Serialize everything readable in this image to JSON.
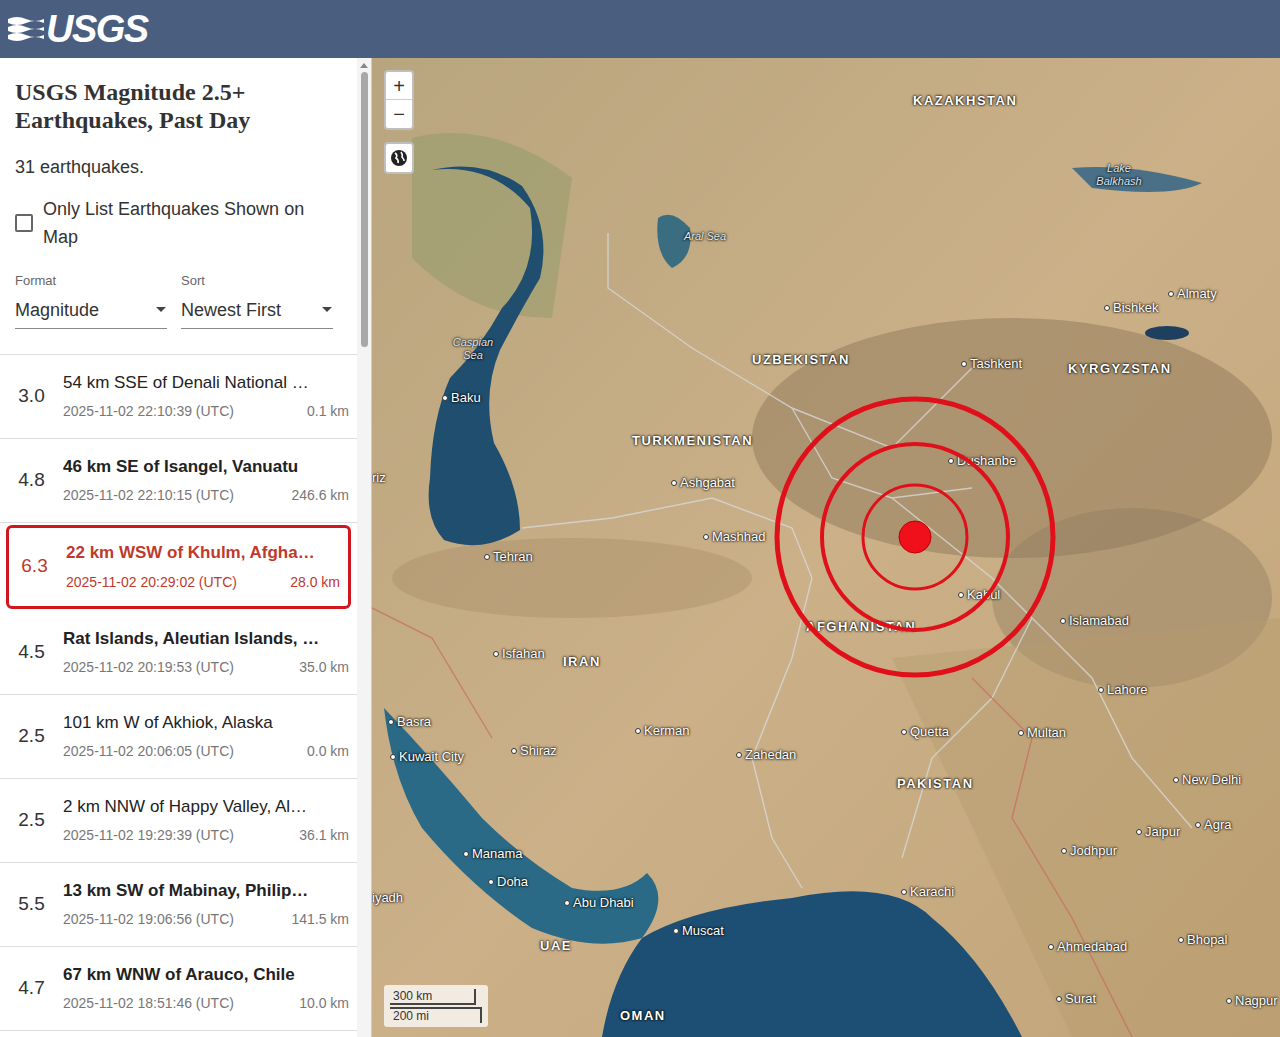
{
  "header": {
    "logo": "USGS"
  },
  "panel": {
    "title": "USGS Magnitude 2.5+ Earthquakes, Past Day",
    "count": "31 earthquakes.",
    "filter": {
      "label": "Only List Earthquakes Shown on Map",
      "checked": false
    },
    "format": {
      "label": "Format",
      "value": "Magnitude"
    },
    "sort": {
      "label": "Sort",
      "value": "Newest First"
    }
  },
  "earthquakes": [
    {
      "magnitude": "3.0",
      "title": "54 km SSE of Denali National …",
      "time": "2025-11-02 22:10:39 (UTC)",
      "depth": "0.1 km",
      "significant": false,
      "selected": false
    },
    {
      "magnitude": "4.8",
      "title": "46 km SE of Isangel, Vanuatu",
      "time": "2025-11-02 22:10:15 (UTC)",
      "depth": "246.6 km",
      "significant": true,
      "selected": false
    },
    {
      "magnitude": "6.3",
      "title": "22 km WSW of Khulm, Afgha…",
      "time": "2025-11-02 20:29:02 (UTC)",
      "depth": "28.0 km",
      "significant": true,
      "selected": true
    },
    {
      "magnitude": "4.5",
      "title": "Rat Islands, Aleutian Islands, …",
      "time": "2025-11-02 20:19:53 (UTC)",
      "depth": "35.0 km",
      "significant": true,
      "selected": false
    },
    {
      "magnitude": "2.5",
      "title": "101 km W of Akhiok, Alaska",
      "time": "2025-11-02 20:06:05 (UTC)",
      "depth": "0.0 km",
      "significant": false,
      "selected": false
    },
    {
      "magnitude": "2.5",
      "title": "2 km NNW of Happy Valley, Al…",
      "time": "2025-11-02 19:29:39 (UTC)",
      "depth": "36.1 km",
      "significant": false,
      "selected": false
    },
    {
      "magnitude": "5.5",
      "title": "13 km SW of Mabinay, Philip…",
      "time": "2025-11-02 19:06:56 (UTC)",
      "depth": "141.5 km",
      "significant": true,
      "selected": false
    },
    {
      "magnitude": "4.7",
      "title": "67 km WNW of Arauco, Chile",
      "time": "2025-11-02 18:51:46 (UTC)",
      "depth": "10.0 km",
      "significant": true,
      "selected": false
    }
  ],
  "map": {
    "zoom_in": "+",
    "zoom_out": "−",
    "scale": {
      "km": "300 km",
      "mi": "200 mi"
    },
    "labels": [
      {
        "text": "KAZAKHSTAN",
        "kind": "country"
      },
      {
        "text": "Lake Balkhash",
        "kind": "water"
      },
      {
        "text": "Aral Sea",
        "kind": "water"
      },
      {
        "text": "Caspian Sea",
        "kind": "water"
      },
      {
        "text": "Bishkek",
        "kind": "city"
      },
      {
        "text": "Almaty",
        "kind": "city"
      },
      {
        "text": "UZBEKISTAN",
        "kind": "country"
      },
      {
        "text": "Tashkent",
        "kind": "city"
      },
      {
        "text": "KYRGYZSTAN",
        "kind": "country"
      },
      {
        "text": "Baku",
        "kind": "city"
      },
      {
        "text": "riz",
        "kind": "cut"
      },
      {
        "text": "TURKMENISTAN",
        "kind": "country"
      },
      {
        "text": "Ashgabat",
        "kind": "city"
      },
      {
        "text": "Dushanbe",
        "kind": "city"
      },
      {
        "text": "Mashhad",
        "kind": "city"
      },
      {
        "text": "Tehran",
        "kind": "city"
      },
      {
        "text": "Kabul",
        "kind": "city"
      },
      {
        "text": "Islamabad",
        "kind": "city"
      },
      {
        "text": "AFGHANISTAN",
        "kind": "country"
      },
      {
        "text": "Isfahan",
        "kind": "city"
      },
      {
        "text": "IRAN",
        "kind": "country"
      },
      {
        "text": "Lahore",
        "kind": "city"
      },
      {
        "text": "Basra",
        "kind": "city"
      },
      {
        "text": "Kuwait City",
        "kind": "city"
      },
      {
        "text": "Shiraz",
        "kind": "city"
      },
      {
        "text": "Kerman",
        "kind": "city"
      },
      {
        "text": "Quetta",
        "kind": "city"
      },
      {
        "text": "Multan",
        "kind": "city"
      },
      {
        "text": "Zahedan",
        "kind": "city"
      },
      {
        "text": "PAKISTAN",
        "kind": "country"
      },
      {
        "text": "New Delhi",
        "kind": "city"
      },
      {
        "text": "Jaipur",
        "kind": "city"
      },
      {
        "text": "Agra",
        "kind": "city"
      },
      {
        "text": "Manama",
        "kind": "city"
      },
      {
        "text": "Doha",
        "kind": "city"
      },
      {
        "text": "Jodhpur",
        "kind": "city"
      },
      {
        "text": "Karachi",
        "kind": "city"
      },
      {
        "text": "iyadh",
        "kind": "cut"
      },
      {
        "text": "Abu Dhabi",
        "kind": "city"
      },
      {
        "text": "Muscat",
        "kind": "city"
      },
      {
        "text": "UAE",
        "kind": "country"
      },
      {
        "text": "Ahmedabad",
        "kind": "city"
      },
      {
        "text": "Bhopal",
        "kind": "city"
      },
      {
        "text": "Surat",
        "kind": "city"
      },
      {
        "text": "Nagpur",
        "kind": "city"
      },
      {
        "text": "OMAN",
        "kind": "country"
      }
    ]
  }
}
